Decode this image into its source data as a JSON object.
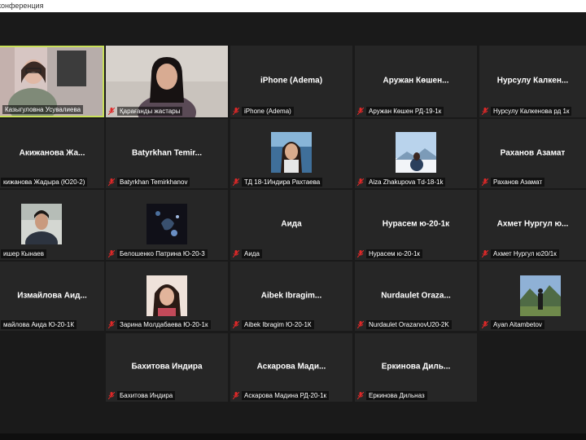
{
  "window": {
    "title": "конференция"
  },
  "colors": {
    "active_border": "#c9e05a",
    "tile_bg": "#262626",
    "muted_mic": "#e02828"
  },
  "participants": [
    {
      "center": "",
      "label": "Казыгуловна Усувалиева",
      "video": true,
      "active": true
    },
    {
      "center": "",
      "label": "Қарағанды жастары",
      "video": true
    },
    {
      "center": "iPhone (Adema)",
      "label": "iPhone (Adema)"
    },
    {
      "center": "Аружан Көшен...",
      "label": "Аружан Көшен РД-19-1к"
    },
    {
      "center": "Нурсулу Калкен...",
      "label": "Нурсулу Калкенова рд 1к"
    },
    {
      "center": "Акижанова Жа...",
      "label": "кижанова Жадыра (Ю20-2)"
    },
    {
      "center": "Batyrkhan Temir...",
      "label": "Batyrkhan Temirkhanov"
    },
    {
      "center": "",
      "label": "ТД 18-1Индира Рахтаева",
      "photo": true
    },
    {
      "center": "",
      "label": "Aiza Zhakupova Td-18-1k",
      "photo": true
    },
    {
      "center": "Раханов Азамат",
      "label": "Раханов Азамат"
    },
    {
      "center": "",
      "label": "ишер Кынаев",
      "photo": true
    },
    {
      "center": "",
      "label": "Белошенко Патрина Ю-20-3",
      "photo": true
    },
    {
      "center": "Аида",
      "label": "Аида"
    },
    {
      "center": "Нурасем ю-20-1к",
      "label": "Нурасем ю-20-1к"
    },
    {
      "center": "Ахмет Нургул ю...",
      "label": "Ахмет Нургул ю20/1к"
    },
    {
      "center": "Измайлова Аид...",
      "label": "майлова Аида Ю-20-1К"
    },
    {
      "center": "",
      "label": "Зарина Молдабаева Ю-20-1к",
      "photo": true
    },
    {
      "center": "Aibek Ibragim...",
      "label": "Aibek Ibragim Ю-20-1К"
    },
    {
      "center": "Nurdaulet Oraza...",
      "label": "Nurdaulet OrazanovU20-2K"
    },
    {
      "center": "",
      "label": "Ayan Aitambetov",
      "photo": true
    },
    {
      "center": "Бахитова Индира",
      "label": "Бахитова Индира"
    },
    {
      "center": "Аскарова Мади...",
      "label": "Аскарова Мадина РД-20-1к"
    },
    {
      "center": "Еркинова Диль...",
      "label": "Еркинова Дильназ"
    }
  ]
}
